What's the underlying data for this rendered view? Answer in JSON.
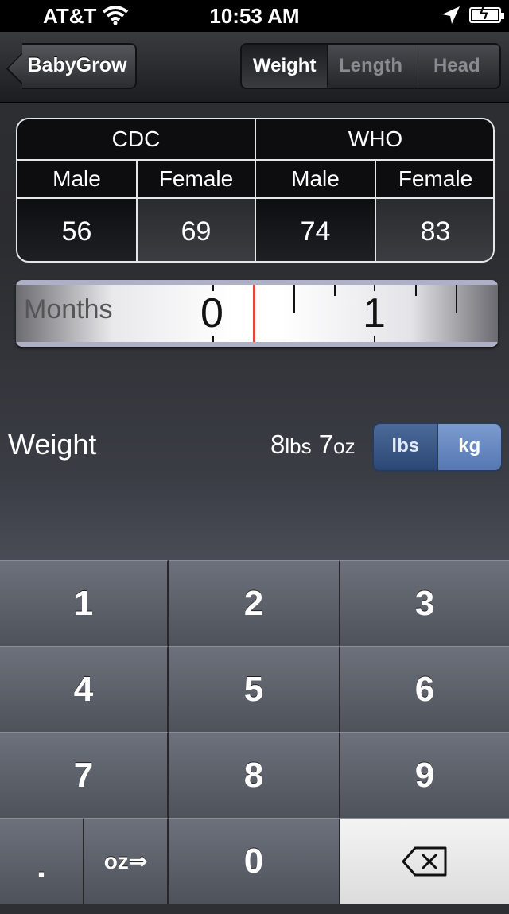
{
  "status_bar": {
    "carrier": "AT&T",
    "time": "10:53 AM"
  },
  "nav": {
    "back_label": "BabyGrow",
    "tabs": [
      {
        "label": "Weight",
        "active": true
      },
      {
        "label": "Length",
        "active": false
      },
      {
        "label": "Head",
        "active": false
      }
    ]
  },
  "percentiles": {
    "groups": [
      "CDC",
      "WHO"
    ],
    "headers": [
      "Male",
      "Female",
      "Male",
      "Female"
    ],
    "values": [
      "56",
      "69",
      "74",
      "83"
    ]
  },
  "age_slider": {
    "label": "Months",
    "markers": [
      "0",
      "1"
    ],
    "value_months": 0.1
  },
  "measurement": {
    "label": "Weight",
    "lbs_value": "8",
    "lbs_unit": "lbs",
    "oz_value": "7",
    "oz_unit": "oz",
    "units": [
      {
        "label": "lbs",
        "selected": true
      },
      {
        "label": "kg",
        "selected": false
      }
    ]
  },
  "keypad": {
    "keys": [
      "1",
      "2",
      "3",
      "4",
      "5",
      "6",
      "7",
      "8",
      "9",
      ".",
      "oz⇒",
      "0",
      "⌫"
    ]
  },
  "colors": {
    "needle": "#e0473c",
    "unit_selected": "#2b4775",
    "keypad_key": "#5c6069"
  }
}
